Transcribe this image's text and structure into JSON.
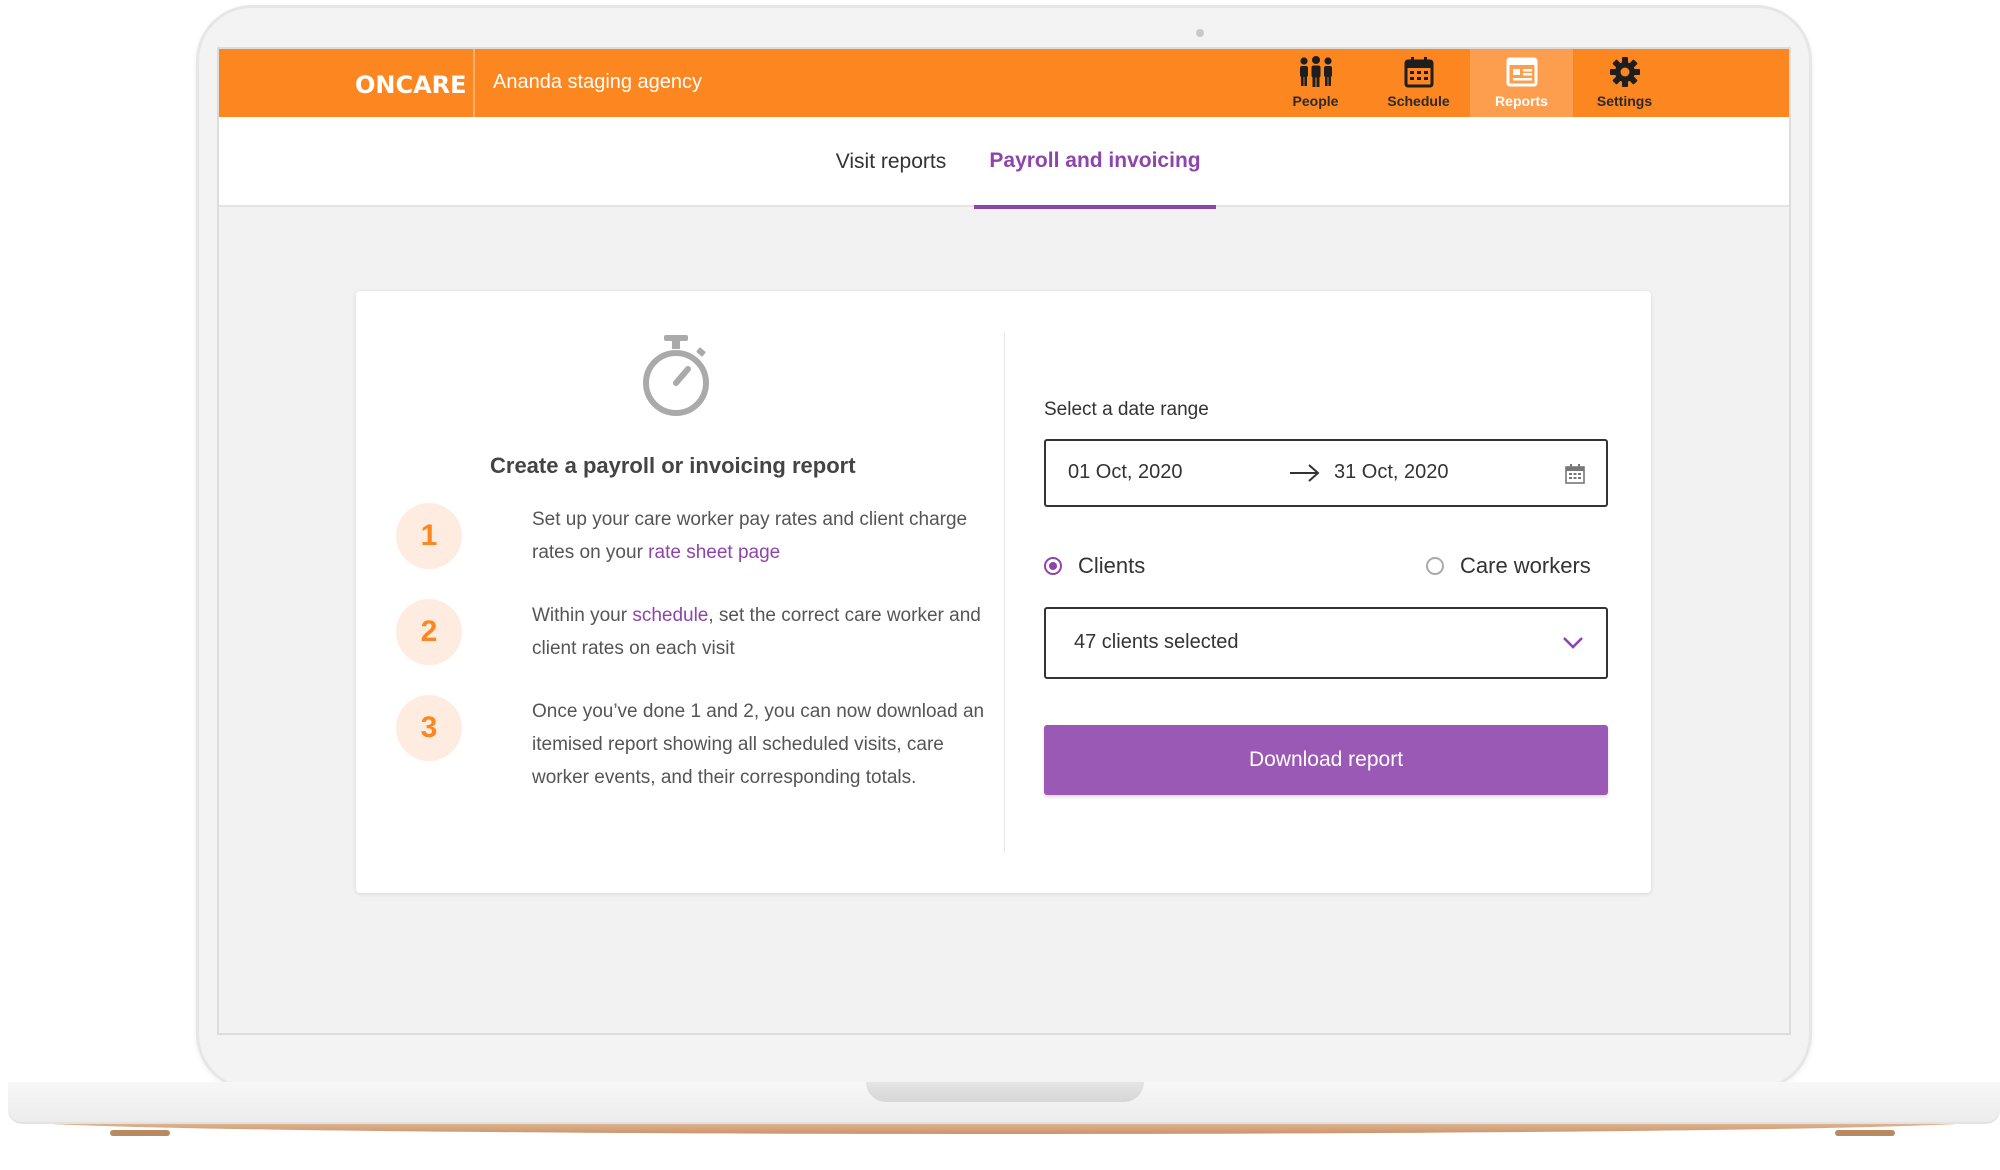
{
  "header": {
    "logo": "ONCARE",
    "agency": "Ananda staging agency",
    "nav": [
      {
        "label": "People",
        "icon": "people-icon",
        "active": false
      },
      {
        "label": "Schedule",
        "icon": "calendar-icon",
        "active": false
      },
      {
        "label": "Reports",
        "icon": "reports-icon",
        "active": true
      },
      {
        "label": "Settings",
        "icon": "gear-icon",
        "active": false
      }
    ]
  },
  "subnav": {
    "tabs": [
      {
        "label": "Visit reports",
        "active": false
      },
      {
        "label": "Payroll and invoicing",
        "active": true
      }
    ]
  },
  "info": {
    "icon": "stopwatch-icon",
    "title": "Create a payroll or invoicing report",
    "steps": [
      {
        "number": "1",
        "before": "Set up your care worker pay rates and client charge rates on your ",
        "link": "rate sheet page",
        "after": ""
      },
      {
        "number": "2",
        "before": "Within your ",
        "link": "schedule",
        "after": ", set the correct care worker and client rates on each visit"
      },
      {
        "number": "3",
        "before": "Once you’ve done 1 and 2, you can now download an itemised report showing all scheduled visits, care worker events, and their corresponding totals.",
        "link": "",
        "after": ""
      }
    ]
  },
  "form": {
    "date_range_label": "Select a date range",
    "date_from": "01 Oct, 2020",
    "date_to": "31 Oct, 2020",
    "radio_clients": "Clients",
    "radio_care_workers": "Care workers",
    "selected_radio": "Clients",
    "select_value": "47 clients selected",
    "download_label": "Download report"
  },
  "colors": {
    "brand_orange": "#fc861f",
    "accent_purple": "#8e44ad",
    "button_purple": "#9b59b6"
  }
}
